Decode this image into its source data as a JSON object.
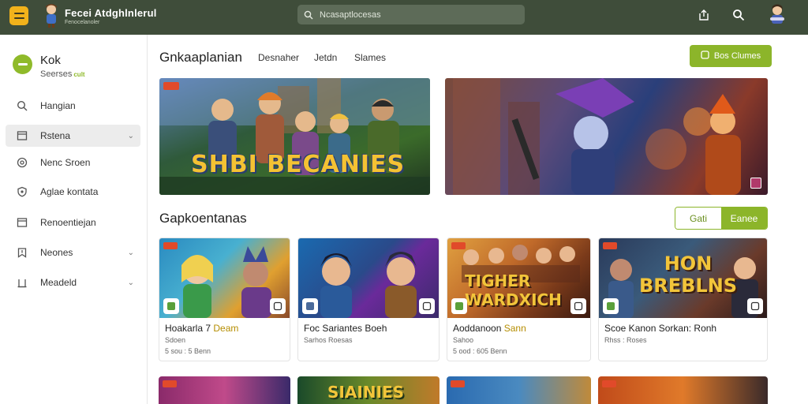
{
  "app": {
    "name": "Fecei Atdghlnlerul",
    "subtitle": "Fenocelanoler"
  },
  "topbar": {
    "search_placeholder": "Ncasaptlocesas"
  },
  "profile": {
    "name": "Kok",
    "sub": "Seerses",
    "tag": "cult"
  },
  "sidebar": {
    "items": [
      {
        "label": "Hangian",
        "icon": "search-icon"
      },
      {
        "label": "Rstena",
        "icon": "window-icon"
      },
      {
        "label": "Nenc Sroen",
        "icon": "disc-icon"
      },
      {
        "label": "Aglae kontata",
        "icon": "shield-icon"
      },
      {
        "label": "Renoentiejan",
        "icon": "window-icon"
      },
      {
        "label": "Neones",
        "icon": "bookmark-icon"
      },
      {
        "label": "Meadeld",
        "icon": "trash-icon"
      }
    ]
  },
  "main": {
    "title": "Gnkaaplanian",
    "tabs": [
      "Desnaher",
      "Jetdn",
      "Slames"
    ],
    "primary_button": "Bos Clumes"
  },
  "banners": [
    {
      "title": "SHBI BECANIES"
    },
    {
      "title": ""
    }
  ],
  "section": {
    "title": "Gapkoentanas",
    "toggle": [
      "Gati",
      "Eanee"
    ]
  },
  "cards": [
    {
      "thumb_text": "",
      "title_a": "Hoakarla 7 ",
      "title_b": "Deam",
      "meta1": "Sdoen",
      "meta2": "5 sou : 5 Benn"
    },
    {
      "thumb_text": "",
      "title_a": "Foc Sariantes Boeh",
      "title_b": "",
      "meta1": "Sarhos Roesas",
      "meta2": ""
    },
    {
      "thumb_text": "TIGHER WARDXICH",
      "title_a": "Aoddanoon ",
      "title_b": "Sann",
      "meta1": "Sahoo",
      "meta2": "5 ood : 605 Benn"
    },
    {
      "thumb_text": "HON BREBLNS",
      "title_a": "Scoe Kanon Sorkan: Ronh",
      "title_b": "",
      "meta1": "Rhss : Roses",
      "meta2": ""
    }
  ],
  "row2": [
    {
      "text": ""
    },
    {
      "text": "SIAINIES"
    },
    {
      "text": ""
    },
    {
      "text": ""
    }
  ],
  "colors": {
    "topbar": "#3f4d3a",
    "accent": "#8cb52a",
    "menu_button": "#f2b21b"
  }
}
